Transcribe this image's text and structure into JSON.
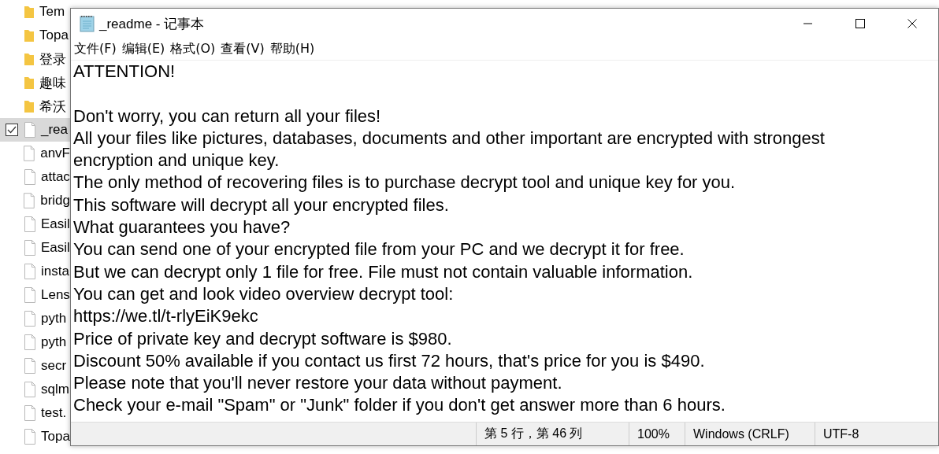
{
  "explorer": {
    "items": [
      {
        "name": "Tem",
        "kind": "folder",
        "selected": false
      },
      {
        "name": "Topa",
        "kind": "folder",
        "selected": false
      },
      {
        "name": "登录",
        "kind": "folder",
        "selected": false
      },
      {
        "name": "趣味",
        "kind": "folder",
        "selected": false
      },
      {
        "name": "希沃",
        "kind": "folder",
        "selected": false
      },
      {
        "name": "_rea",
        "kind": "file",
        "selected": true
      },
      {
        "name": "anvF",
        "kind": "file",
        "selected": false
      },
      {
        "name": "attac",
        "kind": "file",
        "selected": false
      },
      {
        "name": "bridg",
        "kind": "file",
        "selected": false
      },
      {
        "name": "Easil",
        "kind": "file",
        "selected": false
      },
      {
        "name": "Easil",
        "kind": "file",
        "selected": false
      },
      {
        "name": "insta",
        "kind": "file",
        "selected": false
      },
      {
        "name": "Lens",
        "kind": "file",
        "selected": false
      },
      {
        "name": "pyth",
        "kind": "file",
        "selected": false
      },
      {
        "name": "pyth",
        "kind": "file",
        "selected": false
      },
      {
        "name": "secr",
        "kind": "file",
        "selected": false
      },
      {
        "name": "sqlm",
        "kind": "file",
        "selected": false
      },
      {
        "name": "test.",
        "kind": "file",
        "selected": false
      },
      {
        "name": "Topa",
        "kind": "file",
        "selected": false
      }
    ]
  },
  "window": {
    "title": "_readme - 记事本"
  },
  "menu": [
    "文件(F)",
    "编辑(E)",
    "格式(O)",
    "查看(V)",
    "帮助(H)"
  ],
  "document": {
    "paragraphs": [
      [
        "ATTENTION!"
      ],
      [
        "Don't worry, you can return all your files!",
        "All your files like pictures, databases, documents and other important are encrypted with strongest",
        "encryption and unique key.",
        "The only method of recovering files is to purchase decrypt tool and unique key for you.",
        "This software will decrypt all your encrypted files.",
        "What guarantees you have?",
        "You can send one of your encrypted file from your PC and we decrypt it for free.",
        "But we can decrypt only 1 file for free. File must not contain valuable information.",
        "You can get and look video overview decrypt tool:",
        "https://we.tl/t-rlyEiK9ekc",
        "Price of private key and decrypt software is $980.",
        "Discount 50% available if you contact us first 72 hours, that's price for you is $490.",
        "Please note that you'll never restore your data without payment.",
        "Check your e-mail \"Spam\" or \"Junk\" folder if you don't get answer more than 6 hours."
      ]
    ]
  },
  "status_bar": {
    "position": "第 5 行，第 46 列",
    "zoom": "100%",
    "line_ending": "Windows (CRLF)",
    "encoding": "UTF-8"
  }
}
